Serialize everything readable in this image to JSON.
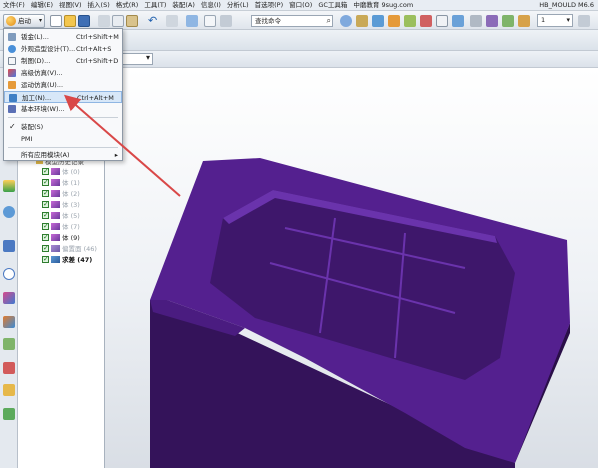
{
  "menubar": {
    "items": [
      "文件(F)",
      "编辑(E)",
      "视图(V)",
      "插入(S)",
      "格式(R)",
      "工具(T)",
      "装配(A)",
      "信息(I)",
      "分析(L)",
      "首选项(P)",
      "窗口(O)",
      "GC工具箱",
      "中磨教育 9sug.com"
    ],
    "window_title": "HB_MOULD M6.6"
  },
  "toolbar": {
    "start_label": "启动",
    "command_search_placeholder": "查找命令",
    "layer_value": "1"
  },
  "start_menu": {
    "items": [
      {
        "label": "钣金(L)...",
        "shortcut": "Ctrl+Shift+M",
        "icon": "sheet-metal-icon"
      },
      {
        "label": "外观造型设计(T)...",
        "shortcut": "Ctrl+Alt+S",
        "icon": "shape-studio-icon"
      },
      {
        "label": "制图(D)...",
        "shortcut": "Ctrl+Shift+D",
        "icon": "drafting-icon"
      },
      {
        "label": "高级仿真(V)...",
        "shortcut": "",
        "icon": "advanced-simulation-icon"
      },
      {
        "label": "运动仿真(U)...",
        "shortcut": "",
        "icon": "motion-simulation-icon"
      },
      {
        "label": "加工(N)...",
        "shortcut": "Ctrl+Alt+M",
        "icon": "manufacturing-icon"
      },
      {
        "label": "基本环境(W)...",
        "shortcut": "",
        "icon": "gateway-icon"
      },
      {
        "label": "装配(S)",
        "shortcut": "",
        "icon": "check-icon"
      },
      {
        "label": "PMI",
        "shortcut": "",
        "icon": ""
      },
      {
        "label": "所有应用模块(A)",
        "shortcut": "",
        "icon": ""
      }
    ]
  },
  "navigator": {
    "header_partial": "模型历史记录",
    "rows": [
      {
        "label": "体 (0)",
        "style": "dim"
      },
      {
        "label": "体 (1)",
        "style": "dim"
      },
      {
        "label": "体 (2)",
        "style": "dim"
      },
      {
        "label": "体 (3)",
        "style": "dim"
      },
      {
        "label": "体 (5)",
        "style": "dim"
      },
      {
        "label": "体 (7)",
        "style": "dim"
      },
      {
        "label": "体 (9)",
        "style": "normal"
      },
      {
        "label": "偏置面 (46)",
        "style": "dim"
      },
      {
        "label": "求差 (47)",
        "style": "bold"
      }
    ]
  },
  "colors": {
    "accent": "#1f5fae",
    "part_top": "#54208f",
    "part_front": "#3a1560",
    "part_side": "#2a0f48",
    "arrow": "#d94848"
  }
}
